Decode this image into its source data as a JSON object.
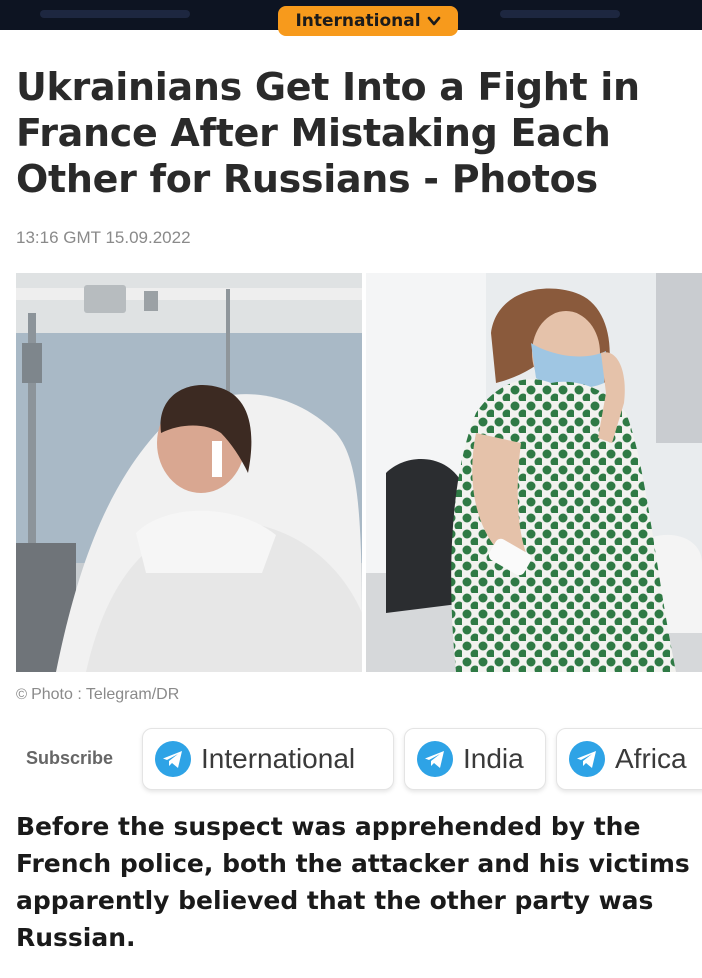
{
  "header": {
    "section_label": "International",
    "section_icon": "chevron-down-icon"
  },
  "article": {
    "title": "Ukrainians Get Into a Fight in France After Mistaking Each Other for Russians - Photos",
    "timestamp": "13:16 GMT 15.09.2022",
    "photo_credit": "Photo : Telegram/DR",
    "lead": "Before the suspect was apprehended by the French police, both the attacker and his victims apparently believed that the other party was Russian."
  },
  "subscribe": {
    "label": "Subscribe",
    "channels": [
      {
        "label": "International",
        "icon": "telegram-icon"
      },
      {
        "label": "India",
        "icon": "telegram-icon"
      },
      {
        "label": "Africa",
        "icon": "telegram-icon"
      }
    ]
  },
  "colors": {
    "accent": "#f79a1c",
    "top_bar": "#0d1422",
    "telegram": "#2ea3e6",
    "muted_text": "#8a8a8a"
  }
}
